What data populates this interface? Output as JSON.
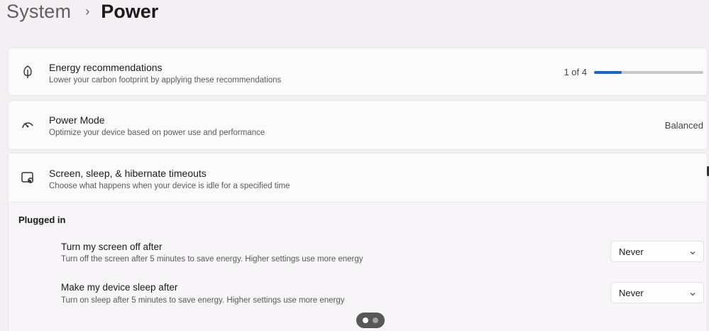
{
  "breadcrumb": {
    "parent": "System",
    "separator": "›",
    "current": "Power"
  },
  "energy": {
    "title": "Energy recommendations",
    "subtitle": "Lower your carbon footprint by applying these recommendations",
    "progress_text": "1 of 4",
    "progress_fraction": 0.25,
    "icon": "leaf-icon"
  },
  "power_mode": {
    "title": "Power Mode",
    "subtitle": "Optimize your device based on power use and performance",
    "value": "Balanced",
    "icon": "power-mode-gauge-icon"
  },
  "timeouts": {
    "title": "Screen, sleep, & hibernate timeouts",
    "subtitle": "Choose what happens when your device is idle for a specified time",
    "icon": "screen-sleep-icon"
  },
  "plugged_in": {
    "label": "Plugged in",
    "settings": [
      {
        "title": "Turn my screen off after",
        "subtitle": "Turn off the screen after 5 minutes to save energy. Higher settings use more energy",
        "value": "Never"
      },
      {
        "title": "Make my device sleep after",
        "subtitle": "Turn on sleep after 5 minutes to save energy. Higher settings use more energy",
        "value": "Never"
      }
    ]
  },
  "colors": {
    "accent": "#1a66c9",
    "background": "#f3eff3",
    "card": "#fbfbfb"
  }
}
